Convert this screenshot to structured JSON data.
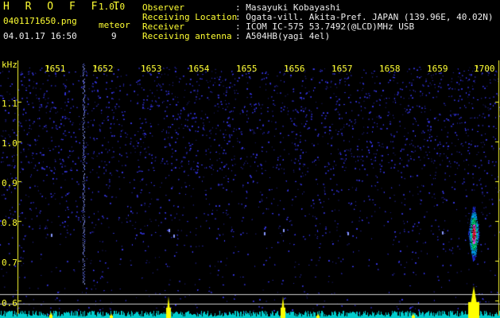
{
  "header": {
    "app_title": "H R O F F T",
    "app_version": "1.0.0",
    "file_name": "0401171650.png",
    "meteor_label": "meteor",
    "datetime": "04.01.17 16:50",
    "meteor_count": "9",
    "info": [
      {
        "key": "Observer",
        "value": ": Masayuki Kobayashi"
      },
      {
        "key": "Receiving Location",
        "value": ": Ogata-vill. Akita-Pref. JAPAN (139.96E, 40.02N)"
      },
      {
        "key": "Receiver",
        "value": ": ICOM IC-575 53.7492(@LCD)MHz USB"
      },
      {
        "key": "Receiving antenna",
        "value": ": A504HB(yagi 4el)"
      }
    ]
  },
  "plot": {
    "y_unit": "kHz",
    "time_ticks": [
      "1651",
      "1652",
      "1653",
      "1654",
      "1655",
      "1656",
      "1657",
      "1658",
      "1659",
      "1700"
    ],
    "freq_ticks": [
      "1.1",
      "1.0",
      "0.9",
      "0.8",
      "0.7",
      "0.6"
    ],
    "colors": {
      "background": "#000000",
      "noise": "#3a3aff",
      "axis": "#ffff33",
      "trace": "#ffff00",
      "baseline": "#00cccc"
    }
  }
}
